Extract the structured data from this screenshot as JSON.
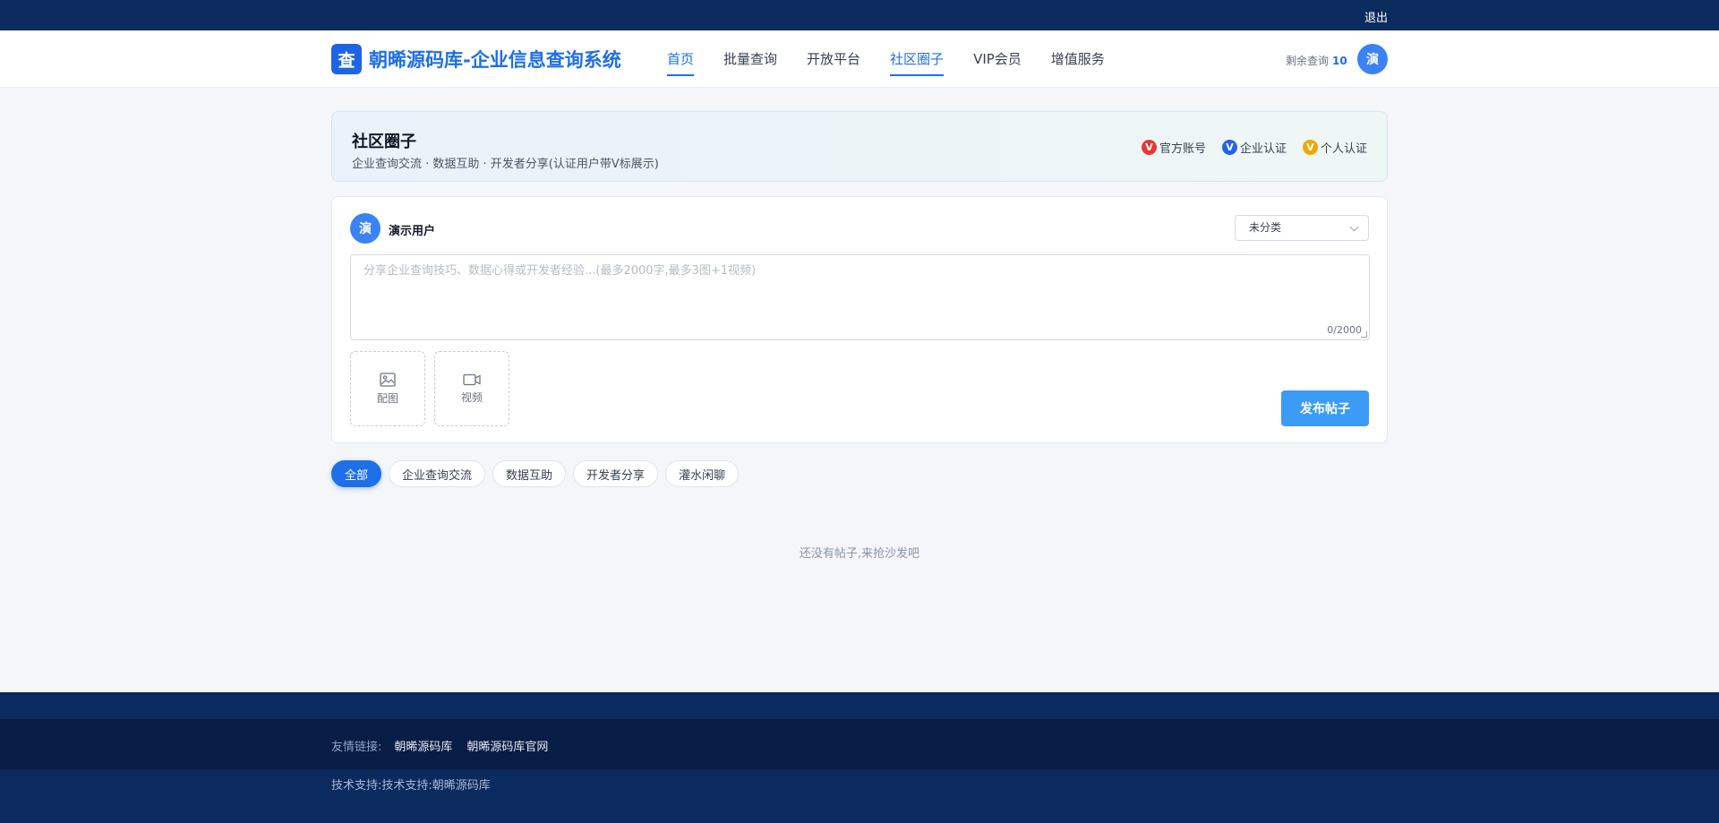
{
  "topbar": {
    "logout": "退出"
  },
  "header": {
    "logo_glyph": "查",
    "brand": "朝晞源码库-企业信息查询系统",
    "nav": [
      {
        "label": "首页",
        "active": true
      },
      {
        "label": "批量查询",
        "active": false
      },
      {
        "label": "开放平台",
        "active": false
      },
      {
        "label": "社区圈子",
        "active": true
      },
      {
        "label": "VIP会员",
        "active": false
      },
      {
        "label": "增值服务",
        "active": false
      }
    ],
    "quota_label": "剩余查询",
    "quota_value": "10",
    "avatar": "演"
  },
  "banner": {
    "title": "社区圈子",
    "subtitle": "企业查询交流 · 数据互助 · 开发者分享(认证用户带V标展示)",
    "legend": [
      {
        "badge": "V",
        "label": "官方账号",
        "color": "#e53935"
      },
      {
        "badge": "V",
        "label": "企业认证",
        "color": "#2563eb"
      },
      {
        "badge": "V",
        "label": "个人认证",
        "color": "#f0a800"
      }
    ]
  },
  "composer": {
    "avatar": "演",
    "username": "演示用户",
    "category": "未分类",
    "placeholder": "分享企业查询技巧、数据心得或开发者经验...(最多2000字,最多3图+1视频)",
    "counter": "0/2000",
    "image_label": "配图",
    "video_label": "视频",
    "publish": "发布帖子"
  },
  "filters": [
    {
      "label": "全部",
      "active": true
    },
    {
      "label": "企业查询交流",
      "active": false
    },
    {
      "label": "数据互助",
      "active": false
    },
    {
      "label": "开发者分享",
      "active": false
    },
    {
      "label": "灌水闲聊",
      "active": false
    }
  ],
  "empty": "还没有帖子,来抢沙发吧",
  "footer": {
    "links_label": "友情链接:",
    "links": [
      "朝晞源码库",
      "朝晞源码库官网"
    ],
    "support": "技术支持:技术支持:朝晞源码库"
  },
  "colors": {
    "primary": "#1e6fe8",
    "header_dark": "#0b2a5e",
    "publish": "#3b9bf7"
  }
}
